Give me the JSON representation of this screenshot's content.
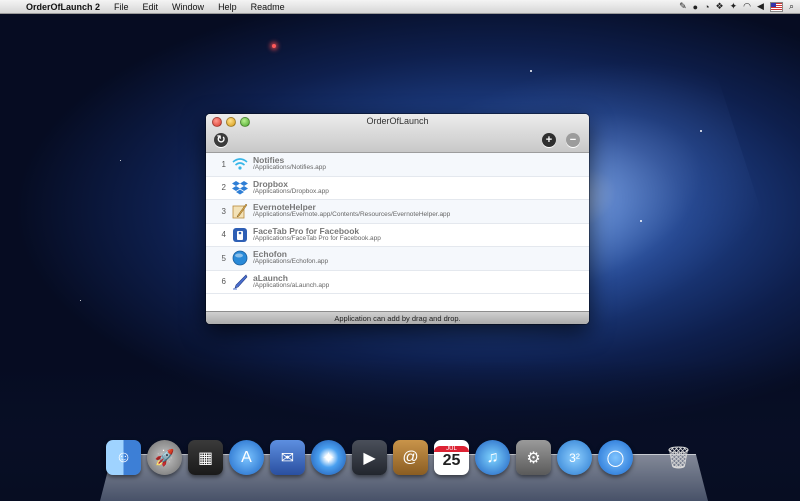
{
  "menubar": {
    "apple_glyph": "",
    "app_name": "OrderOfLaunch 2",
    "items": [
      "File",
      "Edit",
      "Window",
      "Help",
      "Readme"
    ]
  },
  "window": {
    "title": "OrderOfLaunch",
    "footer": "Application can add by drag and drop.",
    "toolbar": {
      "refresh_icon": "refresh-icon",
      "add_icon": "plus-icon",
      "remove_icon": "minus-icon"
    },
    "apps": [
      {
        "index": "1",
        "name": "Notifies",
        "path": "/Applications/Notifies.app",
        "icon": "wifi-signal-icon",
        "color": "#38b6e8"
      },
      {
        "index": "2",
        "name": "Dropbox",
        "path": "/Applications/Dropbox.app",
        "icon": "dropbox-icon",
        "color": "#2f7fd6"
      },
      {
        "index": "3",
        "name": "EvernoteHelper",
        "path": "/Applications/Evernote.app/Contents/Resources/EvernoteHelper.app",
        "icon": "evernote-pen-icon",
        "color": "#d9a64a"
      },
      {
        "index": "4",
        "name": "FaceTab Pro for Facebook",
        "path": "/Applications/FaceTab Pro for Facebook.app",
        "icon": "facetab-icon",
        "color": "#2e5fb5"
      },
      {
        "index": "5",
        "name": "Echofon",
        "path": "/Applications/Echofon.app",
        "icon": "echofon-bubble-icon",
        "color": "#2a8ad8"
      },
      {
        "index": "6",
        "name": "aLaunch",
        "path": "/Applications/aLaunch.app",
        "icon": "alaunch-pen-icon",
        "color": "#4a6fd0"
      }
    ]
  },
  "dock": {
    "calendar_day": "25",
    "calendar_month": "JUL",
    "icons": [
      "finder-icon",
      "launchpad-icon",
      "dashboard-icon",
      "app-store-icon",
      "mail-icon",
      "safari-icon",
      "facetime-icon",
      "address-book-icon",
      "calendar-icon",
      "itunes-icon",
      "system-preferences-icon",
      "orderoflaunch-icon",
      "echofon-icon",
      "trash-icon"
    ]
  }
}
